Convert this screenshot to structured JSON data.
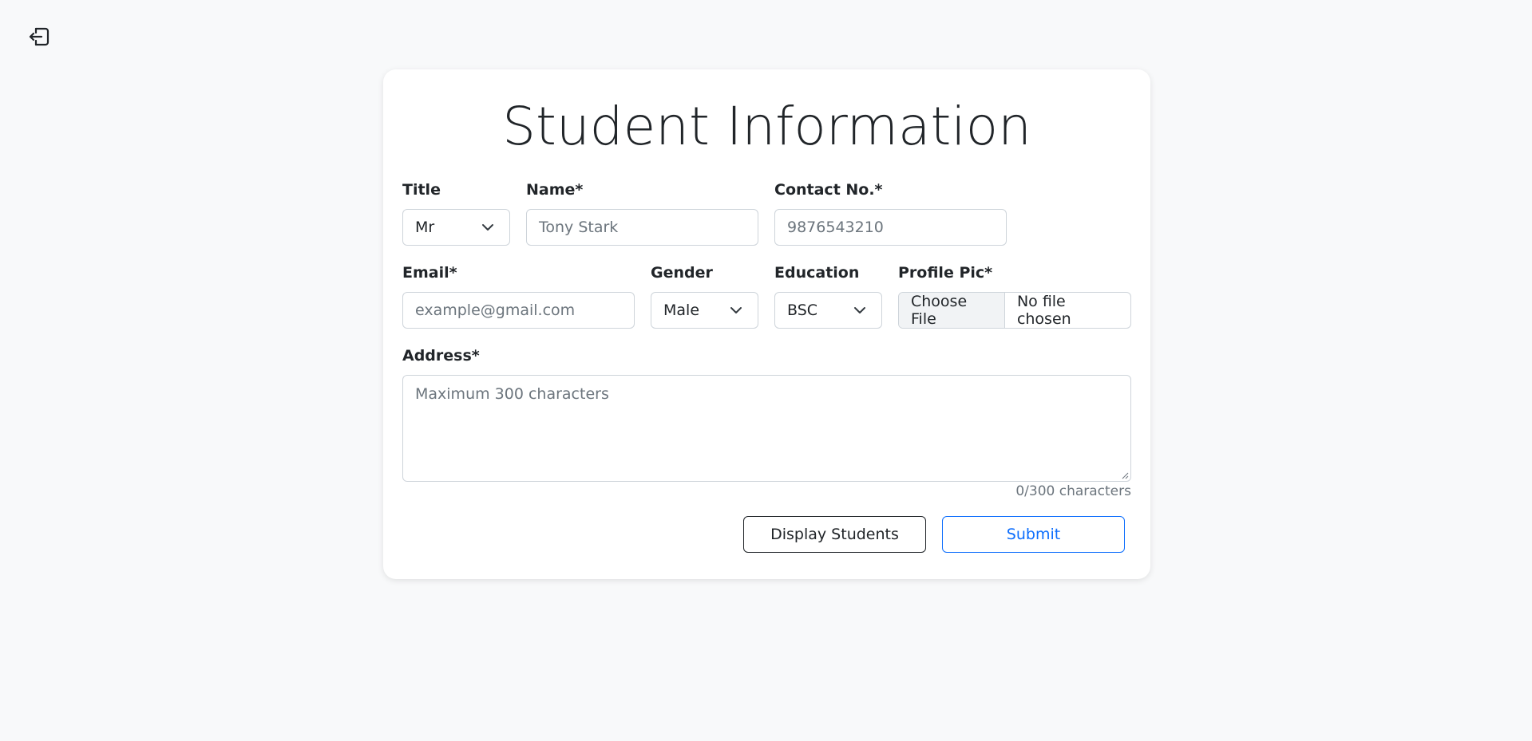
{
  "icons": {
    "logout": "logout-icon",
    "chevron": "chevron-down-icon"
  },
  "colors": {
    "primary": "#0d6efd",
    "background": "#f8f9fa"
  },
  "form": {
    "title": "Student Information",
    "title_field": {
      "label": "Title",
      "value": "Mr"
    },
    "name_field": {
      "label": "Name*",
      "placeholder": "Tony Stark"
    },
    "contact_field": {
      "label": "Contact No.*",
      "placeholder": "9876543210"
    },
    "email_field": {
      "label": "Email*",
      "placeholder": "example@gmail.com"
    },
    "gender_field": {
      "label": "Gender",
      "value": "Male"
    },
    "education_field": {
      "label": "Education",
      "value": "BSC"
    },
    "profile_pic_field": {
      "label": "Profile Pic*",
      "button_label": "Choose File",
      "status": "No file chosen"
    },
    "address_field": {
      "label": "Address*",
      "placeholder": "Maximum 300 characters",
      "char_count": "0/300 characters"
    },
    "buttons": {
      "display_students": "Display Students",
      "submit": "Submit"
    }
  }
}
